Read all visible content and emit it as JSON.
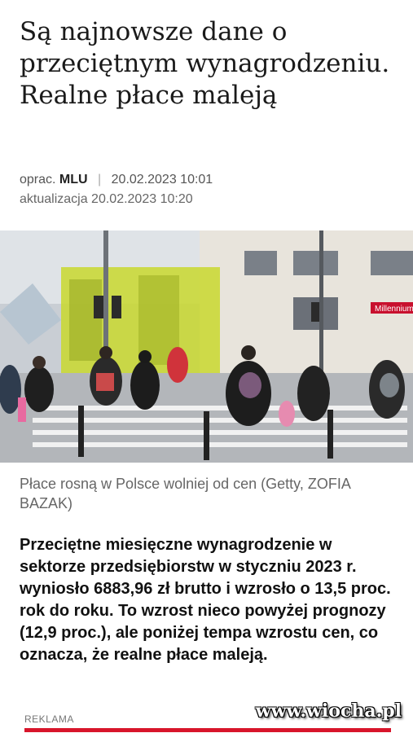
{
  "article": {
    "title": "Są najnowsze dane o przeciętnym wynagrodzeniu. Realne płace maleją",
    "author_prefix": "oprac.",
    "author": "MLU",
    "separator": "|",
    "published": "20.02.2023 10:01",
    "updated": "aktualizacja 20.02.2023 10:20",
    "photo_caption": "Płace rosną w Polsce wolniej od cen (Getty, ZOFIA BAZAK)",
    "lead": "Przeciętne miesięczne wynagrodzenie w sektorze przedsiębiorstw w styczniu 2023 r. wyniosło 6883,96 zł brutto i wzrosło o 13,5 proc. rok do roku. To wzrost nieco powyżej prognozy (12,9 proc.), ale poniżej tempa wzrostu cen, co oznacza, że realne płace maleją."
  },
  "photo": {
    "sign_text": "Millennium"
  },
  "ad": {
    "label": "REKLAMA",
    "accent": "#d8152b"
  },
  "watermark": "www.wiocha.pl"
}
